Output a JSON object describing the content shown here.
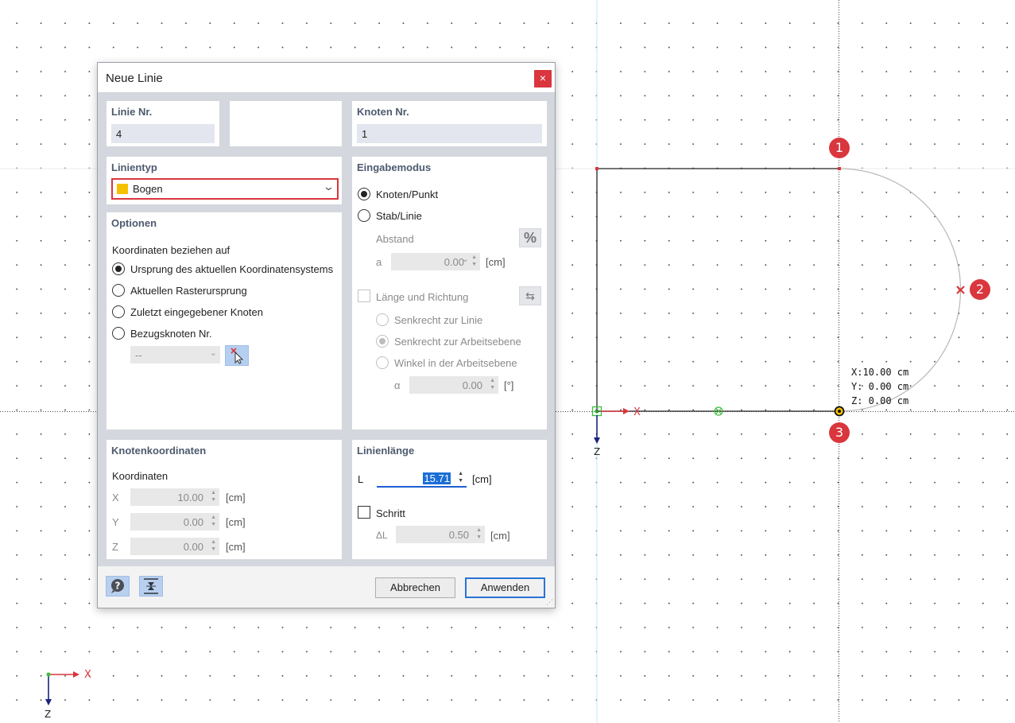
{
  "dialog": {
    "title": "Neue Linie",
    "close": "×",
    "linie_nr": {
      "label": "Linie Nr.",
      "value": "4"
    },
    "knoten_nr": {
      "label": "Knoten Nr.",
      "value": "1"
    },
    "linientyp": {
      "label": "Linientyp",
      "selected": "Bogen",
      "color": "#f6c000"
    },
    "optionen": {
      "title": "Optionen",
      "subtitle": "Koordinaten beziehen auf",
      "options": [
        "Ursprung des aktuellen Koordinatensystems",
        "Aktuellen Rasterursprung",
        "Zuletzt eingegebener Knoten",
        "Bezugsknoten Nr."
      ],
      "selected_index": 0,
      "bezugsknoten_value": "--"
    },
    "eingabemodus": {
      "title": "Eingabemodus",
      "options": [
        "Knoten/Punkt",
        "Stab/Linie"
      ],
      "selected_index": 0,
      "abstand_label": "Abstand",
      "percent_icon": "%",
      "a_label": "a",
      "a_value": "0.00",
      "a_unit": "[cm]",
      "laenge_richtung": "Länge und Richtung",
      "sub_options": [
        "Senkrecht zur Linie",
        "Senkrecht zur Arbeitsebene",
        "Winkel in der Arbeitsebene"
      ],
      "sub_selected_index": 1,
      "alpha_label": "α",
      "alpha_value": "0.00",
      "alpha_unit": "[°]"
    },
    "knotenkoordinaten": {
      "title": "Knotenkoordinaten",
      "subtitle": "Koordinaten",
      "rows": [
        {
          "label": "X",
          "value": "10.00",
          "unit": "[cm]"
        },
        {
          "label": "Y",
          "value": "0.00",
          "unit": "[cm]"
        },
        {
          "label": "Z",
          "value": "0.00",
          "unit": "[cm]"
        }
      ]
    },
    "linienlaenge": {
      "title": "Linienlänge",
      "l_label": "L",
      "l_value": "15.71",
      "l_unit": "[cm]",
      "schritt_label": "Schritt",
      "delta_label": "ΔL",
      "delta_value": "0.50",
      "delta_unit": "[cm]"
    },
    "buttons": {
      "cancel": "Abbrechen",
      "apply": "Anwenden"
    }
  },
  "viewport": {
    "markers": [
      "1",
      "2",
      "3"
    ],
    "coords_readout": [
      "X:10.00 cm",
      "Y: 0.00 cm",
      "Z: 0.00 cm"
    ],
    "axis_labels": {
      "x": "X",
      "z": "Z"
    },
    "colors": {
      "marker": "#d9363e",
      "axis_x": "#d9363e",
      "axis_z": "#1a237e",
      "node_green": "#3cbf3c"
    }
  }
}
